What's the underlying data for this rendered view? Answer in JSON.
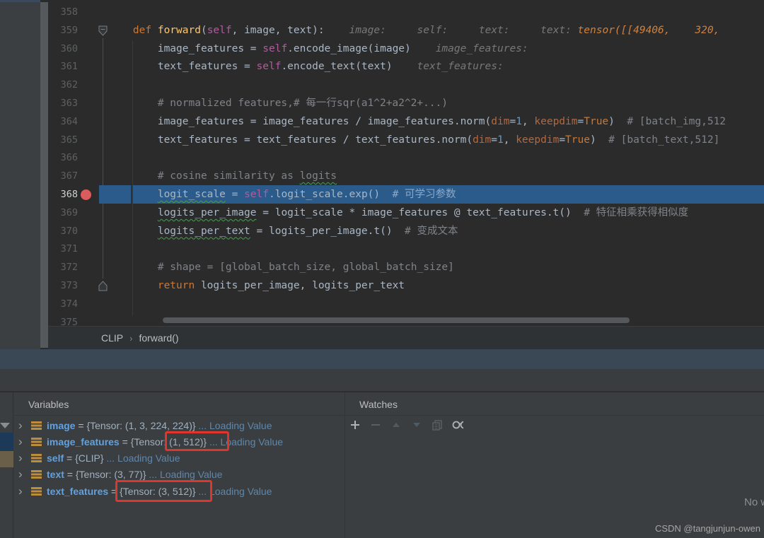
{
  "editor": {
    "breadcrumb": {
      "items": [
        "CLIP",
        "forward()"
      ]
    },
    "lines": [
      {
        "no": "358",
        "seg": []
      },
      {
        "no": "359",
        "fold": "open",
        "seg": [
          [
            "kw",
            "    def "
          ],
          [
            "fn",
            "forward"
          ],
          [
            "d",
            "("
          ],
          [
            "self",
            "self"
          ],
          [
            "d",
            ", image, text):"
          ],
          [
            "hint",
            "    image:"
          ],
          [
            "hint",
            "     self:"
          ],
          [
            "hint",
            "     text:"
          ],
          [
            "hint",
            "     text:"
          ],
          [
            "hintv",
            " tensor([[49406,    320,"
          ]
        ]
      },
      {
        "no": "360",
        "seg": [
          [
            "d",
            "        image_features = "
          ],
          [
            "self",
            "self"
          ],
          [
            "d",
            ".encode_image(image)"
          ],
          [
            "hint",
            "    image_features:"
          ]
        ]
      },
      {
        "no": "361",
        "seg": [
          [
            "d",
            "        text_features = "
          ],
          [
            "self",
            "self"
          ],
          [
            "d",
            ".encode_text(text)"
          ],
          [
            "hint",
            "    text_features:"
          ]
        ]
      },
      {
        "no": "362",
        "seg": []
      },
      {
        "no": "363",
        "seg": [
          [
            "com",
            "        # normalized features,# 每一行sqr(a1^2+a2^2+...)"
          ]
        ]
      },
      {
        "no": "364",
        "seg": [
          [
            "d",
            "        image_features = image_features / image_features.norm("
          ],
          [
            "karg",
            "dim"
          ],
          [
            "d",
            "="
          ],
          [
            "num",
            "1"
          ],
          [
            "d",
            ", "
          ],
          [
            "karg",
            "keepdim"
          ],
          [
            "d",
            "="
          ],
          [
            "kw",
            "True"
          ],
          [
            "d",
            ")"
          ],
          [
            "com",
            "  # [batch_img,512"
          ]
        ]
      },
      {
        "no": "365",
        "seg": [
          [
            "d",
            "        text_features = text_features / text_features.norm("
          ],
          [
            "karg",
            "dim"
          ],
          [
            "d",
            "="
          ],
          [
            "num",
            "1"
          ],
          [
            "d",
            ", "
          ],
          [
            "karg",
            "keepdim"
          ],
          [
            "d",
            "="
          ],
          [
            "kw",
            "True"
          ],
          [
            "d",
            ")"
          ],
          [
            "com",
            "  # [batch_text,512]"
          ]
        ]
      },
      {
        "no": "366",
        "seg": []
      },
      {
        "no": "367",
        "seg": [
          [
            "com",
            "        # cosine similarity as "
          ],
          [
            "comerr",
            "logits"
          ]
        ]
      },
      {
        "no": "368",
        "breakpoint": true,
        "highlight": true,
        "seg": [
          [
            "d",
            "        "
          ],
          [
            "err",
            "logit_scale"
          ],
          [
            "d",
            " = "
          ],
          [
            "self",
            "self"
          ],
          [
            "d",
            ".logit_scale.exp()"
          ],
          [
            "comhl",
            "  # 可学习参数"
          ]
        ]
      },
      {
        "no": "369",
        "seg": [
          [
            "d",
            "        "
          ],
          [
            "err",
            "logits_per_image"
          ],
          [
            "d",
            " = logit_scale * image_features @ text_features.t()"
          ],
          [
            "com",
            "  # 特征相乘获得相似度"
          ]
        ]
      },
      {
        "no": "370",
        "seg": [
          [
            "d",
            "        "
          ],
          [
            "err",
            "logits_per_text"
          ],
          [
            "d",
            " = logits_per_image.t()"
          ],
          [
            "com",
            "  # 变成文本"
          ]
        ]
      },
      {
        "no": "371",
        "seg": []
      },
      {
        "no": "372",
        "seg": [
          [
            "com",
            "        # shape = [global_batch_size, global_batch_size]"
          ]
        ]
      },
      {
        "no": "373",
        "fold": "close",
        "seg": [
          [
            "kw",
            "        return"
          ],
          [
            "d",
            " logits_per_image, logits_per_text"
          ]
        ]
      },
      {
        "no": "374",
        "seg": []
      },
      {
        "no": "375",
        "seg": []
      }
    ]
  },
  "debugger": {
    "variables": {
      "title": "Variables",
      "rows": [
        {
          "name": "image",
          "eq": " = ",
          "value": "{Tensor: (1, 3, 224, 224)}",
          "loading": " ... Loading Value"
        },
        {
          "name": "image_features",
          "eq": " = ",
          "value": "{Tensor: (1, 512)}",
          "loading": " ... Loading Value"
        },
        {
          "name": "self",
          "eq": " = ",
          "value": "{CLIP}",
          "loading": " ... Loading Value"
        },
        {
          "name": "text",
          "eq": " = ",
          "value": "{Tensor: (3, 77)}",
          "loading": " ... Loading Value"
        },
        {
          "name": "text_features",
          "eq": " = ",
          "value": "{Tensor: (3, 512)}",
          "loading": " ... Loading Value"
        }
      ]
    },
    "watches": {
      "title": "Watches",
      "toolbar": [
        {
          "icon": "add",
          "enabled": true
        },
        {
          "icon": "remove",
          "enabled": false
        },
        {
          "icon": "move-up",
          "enabled": false
        },
        {
          "icon": "move-down",
          "enabled": false
        },
        {
          "icon": "duplicate",
          "enabled": false
        },
        {
          "icon": "show-watches-in-variables",
          "enabled": true
        }
      ],
      "empty_text": "No w"
    },
    "annotations": [
      {
        "label": "red-highlight-box",
        "target": "image_features shape (1, 512)"
      },
      {
        "label": "red-highlight-box",
        "target": "text_features {Tensor: (3, 512)}"
      }
    ]
  },
  "watermark": "CSDN @tangjunjun-owen",
  "colors": {
    "editor_bg": "#2B2B2B",
    "panel_bg": "#3B3E40",
    "band_blue": "#3A4755",
    "execution_line": "#2B5B8A",
    "breakpoint": "#DB5C5C",
    "highlight_box": "#E0352B",
    "keyword": "#CC7832",
    "function_name": "#FFC66D",
    "self_keyword": "#B05C9E",
    "comment": "#7F8389",
    "number": "#6897BB",
    "named_arg": "#B3693F",
    "inline_hint": "#787878",
    "inline_hint_value": "#CC8242",
    "variable_name": "#61A1E0",
    "loading_value": "#5D87AD",
    "variable_icon": "#BD8D3F"
  }
}
